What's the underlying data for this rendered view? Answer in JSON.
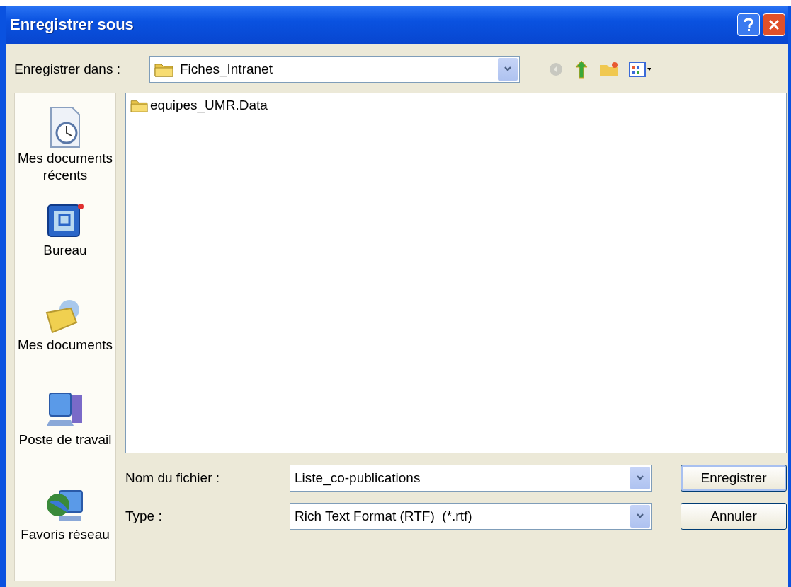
{
  "window": {
    "title": "Enregistrer sous"
  },
  "save_in": {
    "label": "Enregistrer dans :",
    "value": "Fiches_Intranet"
  },
  "places": [
    {
      "kind": "recent",
      "label": "Mes documents récents"
    },
    {
      "kind": "desktop",
      "label": "Bureau"
    },
    {
      "kind": "documents",
      "label": "Mes documents"
    },
    {
      "kind": "computer",
      "label": "Poste de travail"
    },
    {
      "kind": "network",
      "label": "Favoris réseau"
    }
  ],
  "files": [
    {
      "name": "equipes_UMR.Data"
    }
  ],
  "file_name": {
    "label": "Nom du fichier :",
    "value": "Liste_co-publications"
  },
  "file_type": {
    "label": "Type :",
    "value": "Rich Text Format (RTF)  (*.rtf)"
  },
  "buttons": [
    {
      "label": "Enregistrer",
      "default": true
    },
    {
      "label": "Annuler",
      "default": false
    }
  ]
}
